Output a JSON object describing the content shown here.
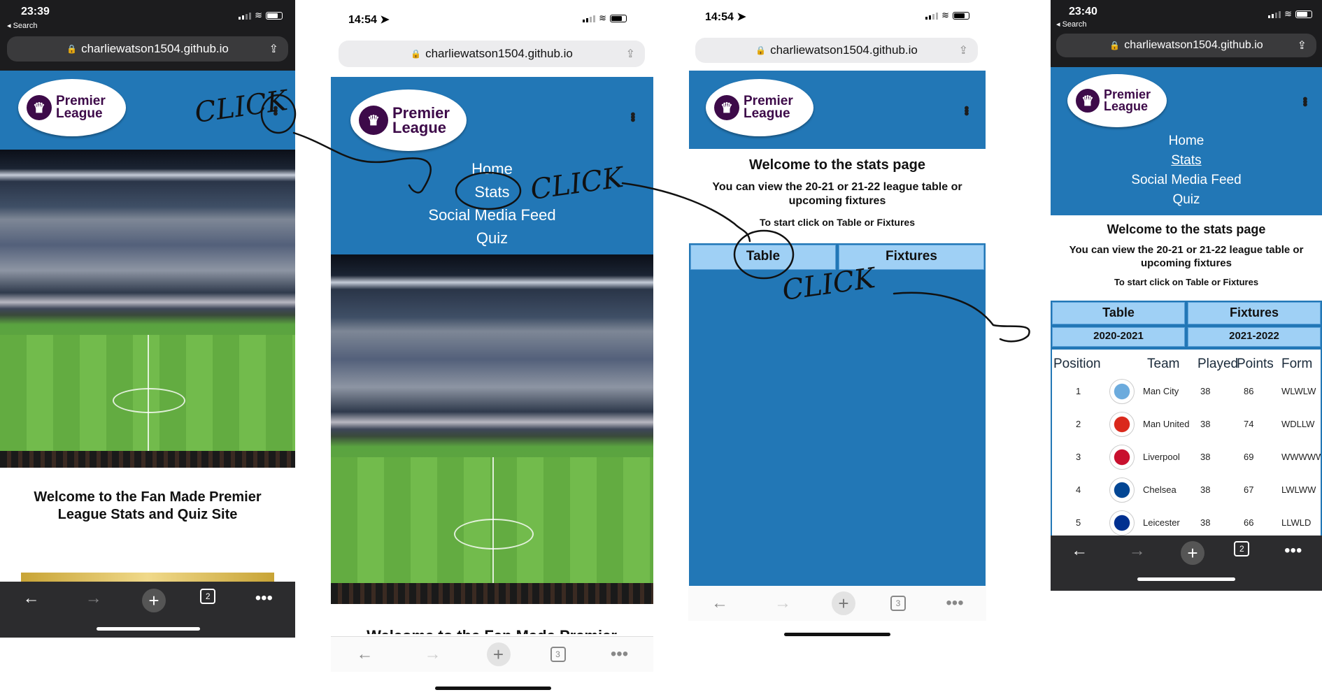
{
  "screens": [
    {
      "time": "23:39",
      "back_label": "◂ Search",
      "url": "charliewatson1504.github.io",
      "welcome": "Welcome to the Fan Made Premier League Stats and Quiz Site",
      "tab_count": "2"
    },
    {
      "time": "14:54 ➤",
      "url": "charliewatson1504.github.io",
      "nav": [
        "Home",
        "Stats",
        "Social Media Feed",
        "Quiz"
      ],
      "welcome_partial": "Welcome to the Fan Made Premier",
      "tab_count": "3"
    },
    {
      "time": "14:54 ➤",
      "url": "charliewatson1504.github.io",
      "title": "Welcome to the stats page",
      "subtitle": "You can view the 20-21 or 21-22 league table or upcoming fixtures",
      "instruction": "To start click on Table or Fixtures",
      "buttons": [
        "Table",
        "Fixtures"
      ],
      "tab_count": "3"
    },
    {
      "time": "23:40",
      "back_label": "◂ Search",
      "url": "charliewatson1504.github.io",
      "nav": [
        "Home",
        "Stats",
        "Social Media Feed",
        "Quiz"
      ],
      "title": "Welcome to the stats page",
      "subtitle": "You can view the 20-21 or 21-22 league table or upcoming fixtures",
      "instruction": "To start click on Table or Fixtures",
      "buttons": [
        "Table",
        "Fixtures"
      ],
      "seasons": [
        "2020-2021",
        "2021-2022"
      ],
      "table": {
        "headers": [
          "Position",
          "Team",
          "Played",
          "Points",
          "Form"
        ],
        "rows": [
          {
            "pos": "1",
            "team": "Man City",
            "played": "38",
            "points": "86",
            "form": "WLWLW",
            "color": "#6cabdd"
          },
          {
            "pos": "2",
            "team": "Man United",
            "played": "38",
            "points": "74",
            "form": "WDLLW",
            "color": "#da291c"
          },
          {
            "pos": "3",
            "team": "Liverpool",
            "played": "38",
            "points": "69",
            "form": "WWWWW",
            "color": "#c8102e"
          },
          {
            "pos": "4",
            "team": "Chelsea",
            "played": "38",
            "points": "67",
            "form": "LWLWW",
            "color": "#034694"
          },
          {
            "pos": "5",
            "team": "Leicester",
            "played": "38",
            "points": "66",
            "form": "LLWLD",
            "color": "#003090"
          }
        ]
      },
      "tab_count": "2"
    }
  ],
  "logo": {
    "line1": "Premier",
    "line2": "League"
  },
  "annotations": {
    "click": "CLICK"
  },
  "colors": {
    "header_blue": "#2277b6",
    "button_blue": "#9fd0f5",
    "logo_purple": "#3d0a49"
  }
}
